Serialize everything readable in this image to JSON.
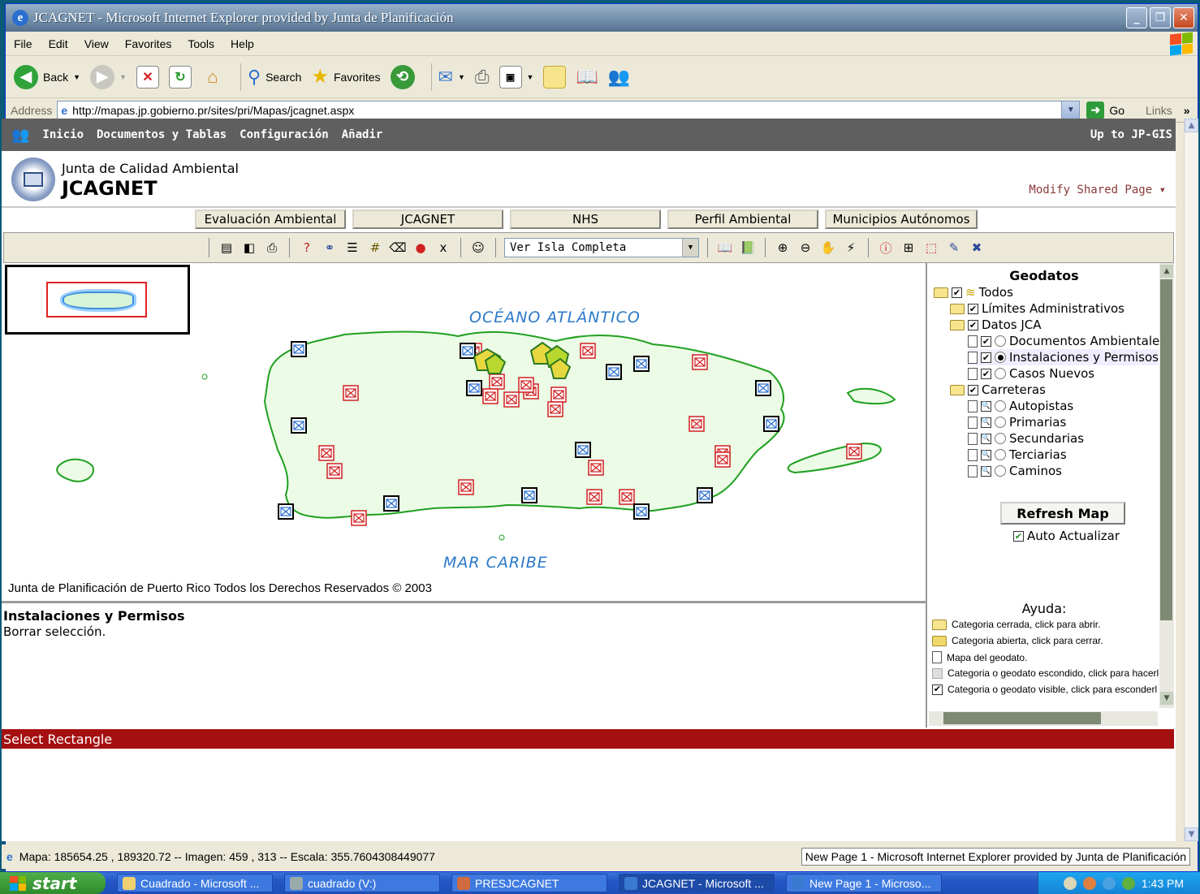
{
  "window": {
    "title": "JCAGNET - Microsoft Internet Explorer provided by Junta de Planificación",
    "icon": "ie-icon"
  },
  "menu": [
    "File",
    "Edit",
    "View",
    "Favorites",
    "Tools",
    "Help"
  ],
  "toolbar": {
    "back": "Back",
    "search": "Search",
    "favorites": "Favorites"
  },
  "address": {
    "label": "Address",
    "url": "http://mapas.jp.gobierno.pr/sites/pri/Mapas/jcagnet.aspx",
    "go": "Go",
    "links": "Links",
    "chevron": "»"
  },
  "sp_nav": {
    "items": [
      "Inicio",
      "Documentos y Tablas",
      "Configuración",
      "Añadir"
    ],
    "up": "Up to JP-GIS"
  },
  "header": {
    "subtitle": "Junta de Calidad Ambiental",
    "title": "JCAGNET",
    "modify": "Modify Shared Page ▾"
  },
  "tabs": [
    "Evaluación Ambiental",
    "JCAGNET",
    "NHS",
    "Perfil Ambiental",
    "Municipios Autónomos"
  ],
  "map_toolbar": {
    "view_select": "Ver Isla Completa"
  },
  "map": {
    "ocean_label": "OCÉANO ATLÁNTICO",
    "sea_label": "MAR CARIBE",
    "copyright": "Junta de Planificación de Puerto Rico Todos los Derechos Reservados © 2003"
  },
  "geodatos": {
    "title": "Geodatos",
    "tree": {
      "root": "Todos",
      "limites": "Límites Administrativos",
      "datos_jca": "Datos JCA",
      "docs": "Documentos Ambientales",
      "instalaciones": "Instalaciones y Permisos",
      "casos": "Casos Nuevos",
      "carreteras": "Carreteras",
      "autopistas": "Autopistas",
      "primarias": "Primarias",
      "secundarias": "Secundarias",
      "terciarias": "Terciarias",
      "caminos": "Caminos"
    },
    "refresh": "Refresh Map",
    "auto": "Auto Actualizar",
    "ayuda_title": "Ayuda:",
    "help": [
      "Categoria cerrada, click para abrir.",
      "Categoria abierta, click para cerrar.",
      "Mapa del geodato.",
      "Categoria o geodato escondido, click para hacerl",
      "Categoria o geodato visible, click para esconderl"
    ]
  },
  "info": {
    "title": "Instalaciones y Permisos",
    "action": "Borrar selección."
  },
  "red_status": "Select Rectangle",
  "ie_status": {
    "left": "Mapa: 185654.25 , 189320.72 -- Imagen: 459 , 313 -- Escala: 355.7604308449077",
    "right": "New Page 1 - Microsoft Internet Explorer provided by Junta de Planificación"
  },
  "taskbar": {
    "start": "start",
    "tasks": [
      "Cuadrado - Microsoft ...",
      "cuadrado (V:)",
      "PRESJCAGNET",
      "JCAGNET - Microsoft ...",
      "New Page 1 - Microso..."
    ],
    "clock": "1:43 PM"
  }
}
